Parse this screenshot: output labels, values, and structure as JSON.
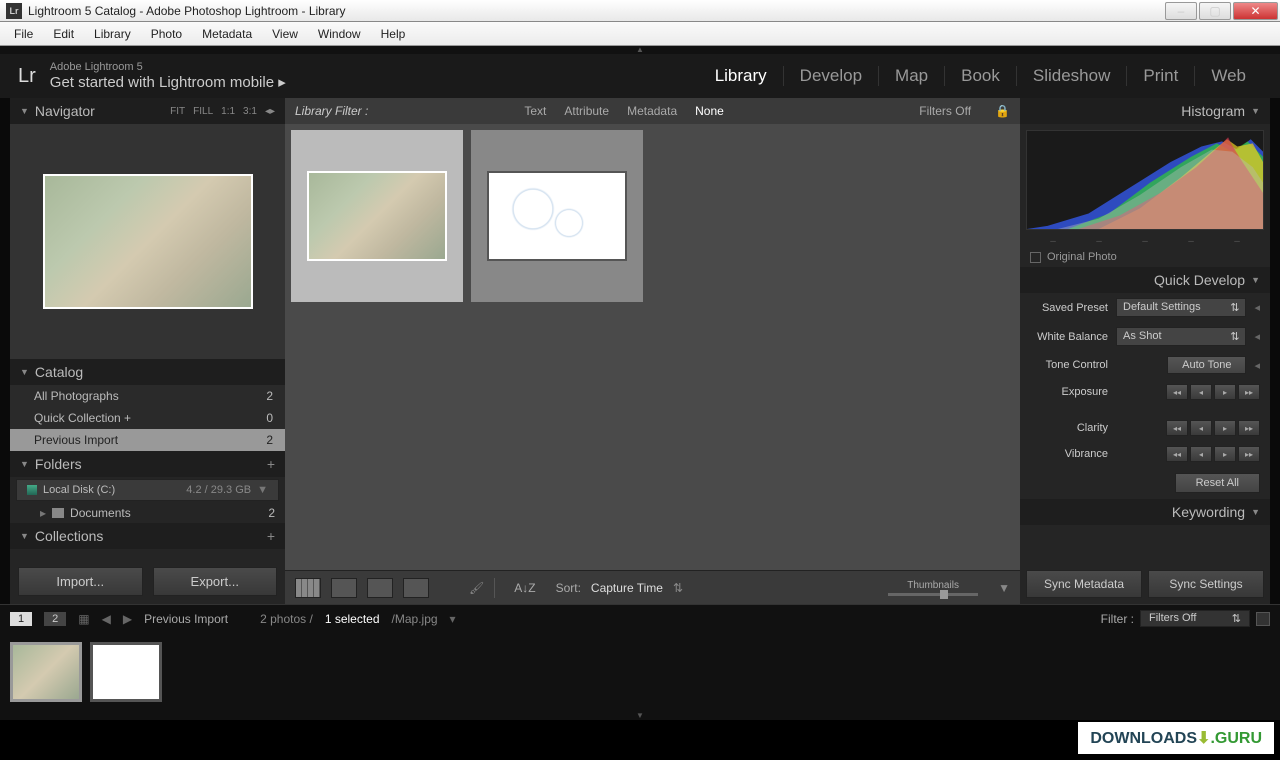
{
  "window": {
    "title": "Lightroom 5 Catalog - Adobe Photoshop Lightroom - Library"
  },
  "menubar": [
    "File",
    "Edit",
    "Library",
    "Photo",
    "Metadata",
    "View",
    "Window",
    "Help"
  ],
  "header": {
    "logo": "Lr",
    "product": "Adobe Lightroom 5",
    "tagline": "Get started with Lightroom mobile  ▸"
  },
  "modules": [
    "Library",
    "Develop",
    "Map",
    "Book",
    "Slideshow",
    "Print",
    "Web"
  ],
  "active_module": "Library",
  "navigator": {
    "title": "Navigator",
    "zoom": [
      "FIT",
      "FILL",
      "1:1",
      "3:1"
    ]
  },
  "catalog": {
    "title": "Catalog",
    "items": [
      {
        "label": "All Photographs",
        "count": "2"
      },
      {
        "label": "Quick Collection  +",
        "count": "0"
      },
      {
        "label": "Previous Import",
        "count": "2"
      }
    ],
    "selected": 2
  },
  "folders": {
    "title": "Folders",
    "disk": {
      "label": "Local Disk (C:)",
      "capacity": "4.2 / 29.3 GB"
    },
    "items": [
      {
        "label": "Documents",
        "count": "2"
      }
    ]
  },
  "collections": {
    "title": "Collections"
  },
  "buttons": {
    "import": "Import...",
    "export": "Export..."
  },
  "library_filter": {
    "label": "Library Filter :",
    "opts": [
      "Text",
      "Attribute",
      "Metadata",
      "None"
    ],
    "active": "None",
    "status": "Filters Off"
  },
  "toolbar": {
    "sort_label": "Sort:",
    "sort_value": "Capture Time",
    "thumbs_label": "Thumbnails"
  },
  "histogram": {
    "title": "Histogram",
    "original": "Original Photo"
  },
  "quick_develop": {
    "title": "Quick Develop",
    "saved_preset": {
      "label": "Saved Preset",
      "value": "Default Settings"
    },
    "white_balance": {
      "label": "White Balance",
      "value": "As Shot"
    },
    "tone_control": {
      "label": "Tone Control",
      "auto": "Auto Tone"
    },
    "sliders": [
      "Exposure",
      "Clarity",
      "Vibrance"
    ],
    "reset": "Reset All"
  },
  "keywording": {
    "title": "Keywording"
  },
  "sync": {
    "metadata": "Sync Metadata",
    "settings": "Sync Settings"
  },
  "statusbar": {
    "page1": "1",
    "page2": "2",
    "breadcrumb": "Previous Import",
    "count": "2 photos /",
    "selected": "1 selected",
    "file": "/Map.jpg",
    "filter_label": "Filter :",
    "filter_value": "Filters Off"
  },
  "watermark": {
    "a": "DOWNLOADS",
    "b": ".GURU"
  }
}
